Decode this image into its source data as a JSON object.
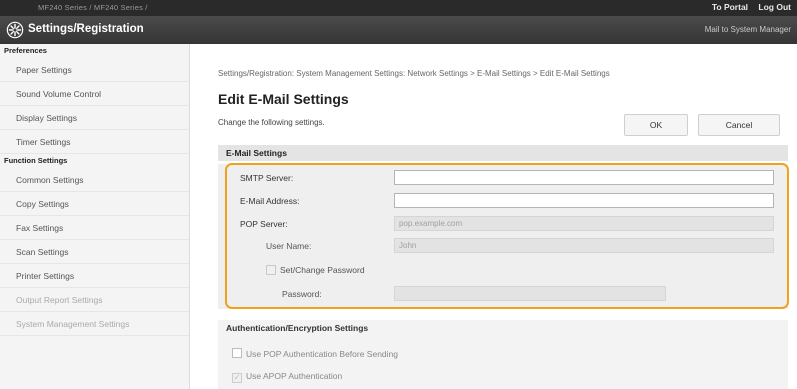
{
  "topbar": {
    "device": "MF240 Series / MF240 Series /",
    "to_portal": "To Portal",
    "log_out": "Log Out"
  },
  "header": {
    "title": "Settings/Registration",
    "mail_link": "Mail to System Manager",
    "icon": "gear-icon"
  },
  "sidebar": {
    "preferences_title": "Preferences",
    "preferences": [
      {
        "label": "Paper Settings"
      },
      {
        "label": "Sound Volume Control"
      },
      {
        "label": "Display Settings"
      },
      {
        "label": "Timer Settings"
      }
    ],
    "function_title": "Function Settings",
    "function": [
      {
        "label": "Common Settings"
      },
      {
        "label": "Copy Settings"
      },
      {
        "label": "Fax Settings"
      },
      {
        "label": "Scan Settings"
      },
      {
        "label": "Printer Settings"
      },
      {
        "label": "Output Report Settings"
      },
      {
        "label": "System Management Settings"
      }
    ]
  },
  "main": {
    "breadcrumb": "Settings/Registration: System Management Settings: Network Settings > E-Mail Settings > Edit E-Mail Settings",
    "title": "Edit E-Mail Settings",
    "subtitle": "Change the following settings.",
    "ok_label": "OK",
    "cancel_label": "Cancel",
    "email_section_title": "E-Mail Settings",
    "smtp_label": "SMTP Server:",
    "smtp_value": "",
    "email_label": "E-Mail Address:",
    "email_value": "",
    "pop_label": "POP Server:",
    "pop_placeholder": "pop.example.com",
    "username_label": "User Name:",
    "username_value": "John",
    "set_password_label": "Set/Change Password",
    "password_label": "Password:",
    "password_value": "",
    "auth_section_title": "Authentication/Encryption Settings",
    "auth_pop_label": "Use POP Authentication Before Sending",
    "auth_apop_label": "Use APOP Authentication"
  },
  "colors": {
    "highlight": "#f2a11c",
    "header": "#3d3d3d",
    "topbar": "#2a2a2a"
  }
}
